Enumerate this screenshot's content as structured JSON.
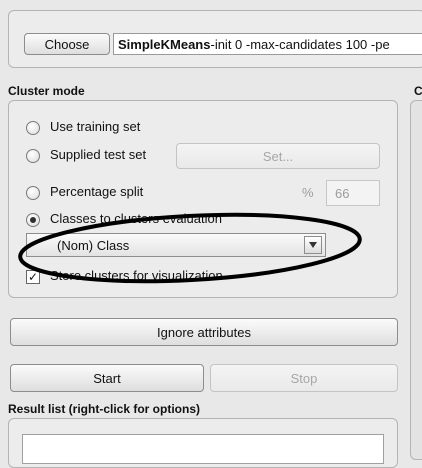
{
  "clusterer": {
    "choose_label": "Choose",
    "algorithm": "SimpleKMeans",
    "options": " -init 0 -max-candidates 100 -pe"
  },
  "cluster_mode": {
    "title": "Cluster mode",
    "use_training_set": "Use training set",
    "supplied_test_set": "Supplied test set",
    "set_button": "Set...",
    "percentage_split": "Percentage split",
    "percent_sign": "%",
    "percent_value": "66",
    "classes_to_clusters": "Classes to clusters evaluation",
    "class_select": "(Nom) Class",
    "store_clusters": "Store clusters for visualization",
    "selected_mode": "classes_to_clusters"
  },
  "right_panel": {
    "title_char": "C"
  },
  "buttons": {
    "ignore_attributes": "Ignore attributes",
    "start": "Start",
    "stop": "Stop"
  },
  "result_list": {
    "title": "Result list (right-click for options)"
  },
  "annotation": {
    "shape": "ellipse",
    "color": "#000000"
  }
}
